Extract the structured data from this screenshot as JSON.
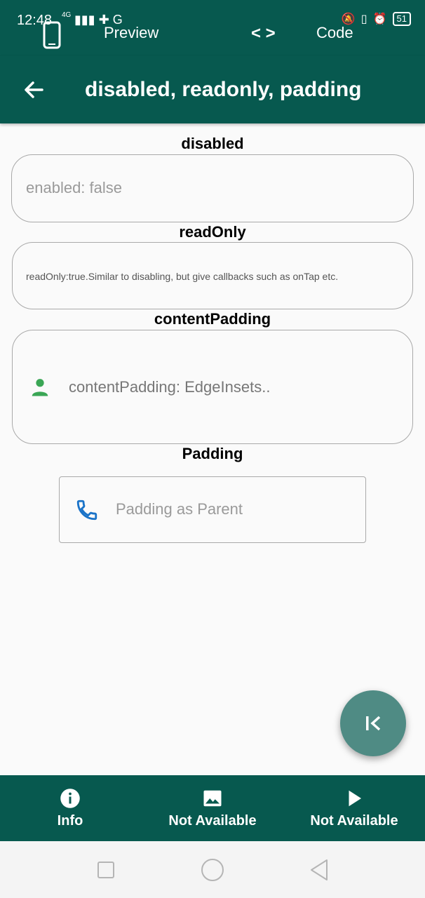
{
  "status_bar": {
    "time": "12:48",
    "network": "4G",
    "battery": "51"
  },
  "top_tabs": {
    "preview_label": "Preview",
    "code_label": "Code",
    "phone_icon": "phone-icon",
    "code_icon": "code-brackets-icon"
  },
  "app_bar": {
    "title": "disabled, readonly, padding",
    "back_icon": "arrow-left-icon"
  },
  "sections": {
    "disabled": {
      "label": "disabled",
      "field_text": "enabled: false"
    },
    "readonly": {
      "label": "readOnly",
      "field_text": "readOnly:true.Similar to disabling, but give callbacks such as onTap etc."
    },
    "content_padding": {
      "label": "contentPadding",
      "field_text": "contentPadding: EdgeInsets..",
      "icon": "person-icon"
    },
    "padding": {
      "label": "Padding",
      "field_hint": "Padding as Parent",
      "icon": "phone-icon"
    }
  },
  "fab": {
    "icon": "collapse-left-icon"
  },
  "bottom_nav": {
    "items": [
      {
        "label": "Info",
        "icon": "info-icon"
      },
      {
        "label": "Not Available",
        "icon": "image-icon"
      },
      {
        "label": "Not Available",
        "icon": "play-icon"
      }
    ]
  },
  "colors": {
    "primary": "#07594f",
    "fab": "#4f8b84",
    "person_icon": "#3aa655",
    "phone_icon": "#1a73c8",
    "hint_text": "#9a9a9a",
    "border": "#a9a9a9"
  }
}
